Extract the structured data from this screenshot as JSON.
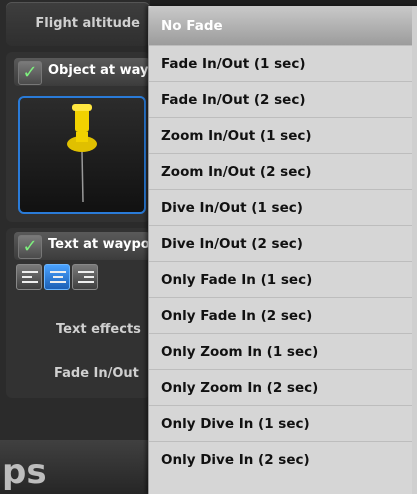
{
  "left_panel": {
    "flight_altitude_label": "Flight altitude",
    "object_header": "Object at way",
    "text_header": "Text at waypo",
    "text_effects_label": "Text effects",
    "fade_label": "Fade In/Out",
    "bottom_text": "ps"
  },
  "dropdown": {
    "options": [
      "No Fade",
      "Fade In/Out (1 sec)",
      "Fade In/Out (2 sec)",
      "Zoom In/Out (1 sec)",
      "Zoom In/Out (2 sec)",
      "Dive In/Out (1 sec)",
      "Dive In/Out (2 sec)",
      "Only Fade In (1 sec)",
      "Only Fade In (2 sec)",
      "Only Zoom In (1 sec)",
      "Only Zoom In (2 sec)",
      "Only Dive In (1 sec)",
      "Only Dive In (2 sec)"
    ],
    "selected": "No Fade"
  },
  "colors": {
    "accent": "#2a7bd8",
    "check": "#7ef07e",
    "pin": "#f2d200"
  },
  "icons": {
    "checkbox": "checkmark-icon",
    "pin": "pushpin-icon"
  }
}
